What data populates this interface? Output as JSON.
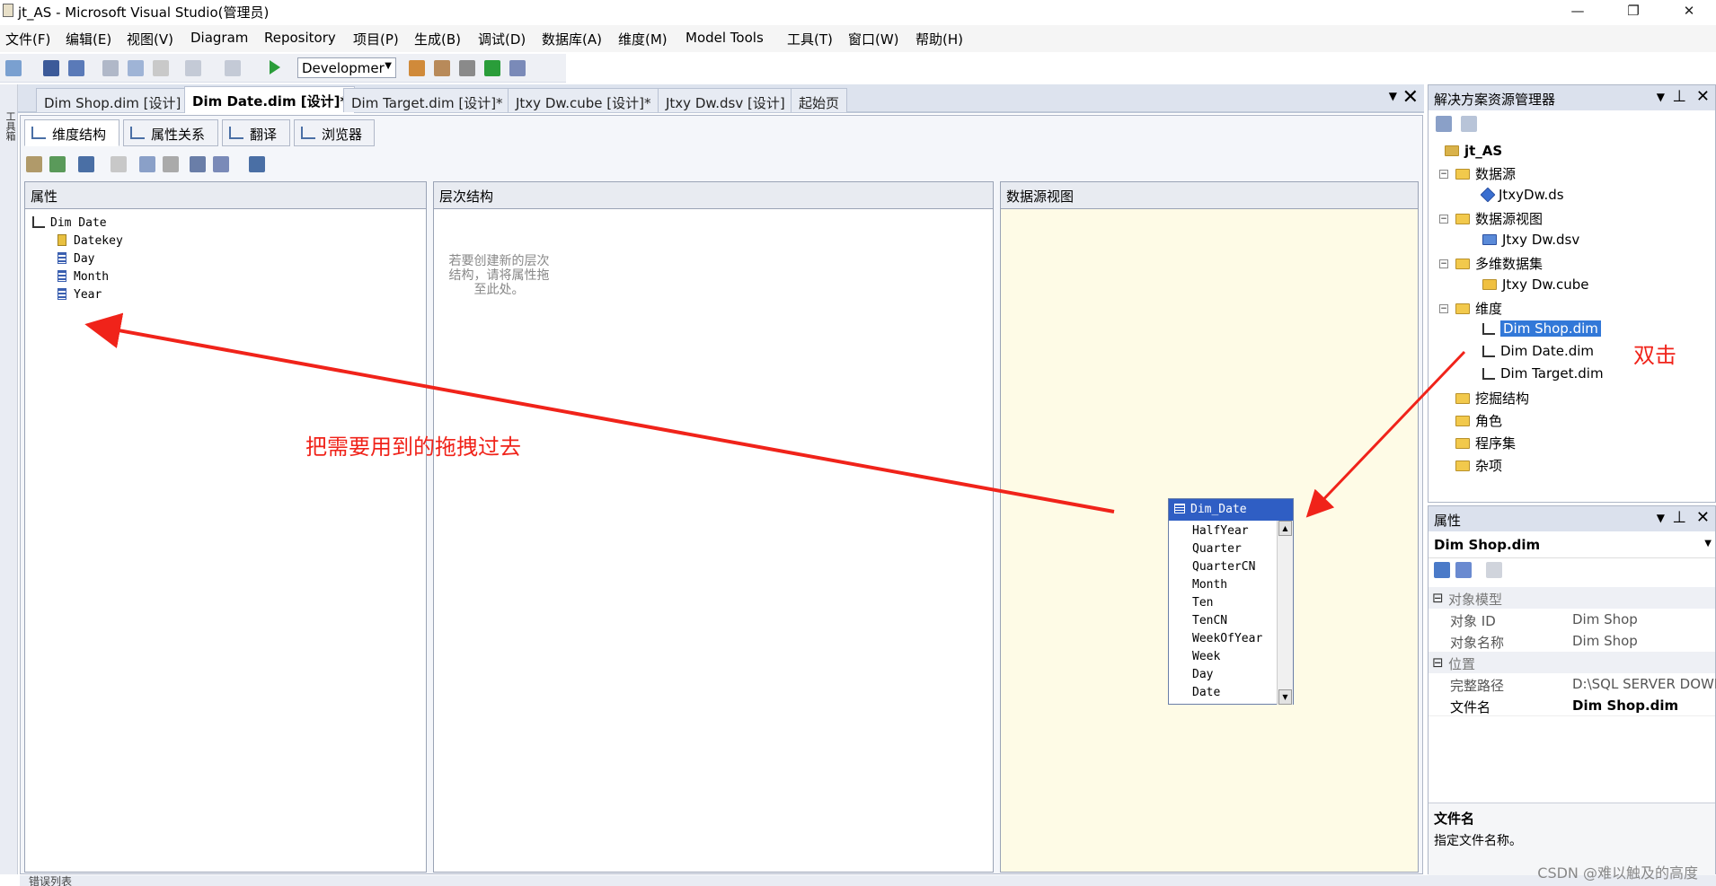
{
  "window": {
    "title": "jt_AS - Microsoft Visual Studio(管理员)",
    "min": "—",
    "restore": "❐",
    "close": "✕"
  },
  "menu": [
    "文件(F)",
    "编辑(E)",
    "视图(V)",
    "Diagram",
    "Repository",
    "项目(P)",
    "生成(B)",
    "调试(D)",
    "数据库(A)",
    "维度(M)",
    "Model Tools",
    "工具(T)",
    "窗口(W)",
    "帮助(H)"
  ],
  "toolbar": {
    "config": "Developmer"
  },
  "toolstrip": {
    "label": "工具箱"
  },
  "doc_tabs": [
    {
      "label": "Dim Shop.dim [设计]",
      "active": false
    },
    {
      "label": "Dim Date.dim [设计]*",
      "active": true
    },
    {
      "label": "Dim Target.dim [设计]*",
      "active": false
    },
    {
      "label": "Jtxy Dw.cube [设计]*",
      "active": false
    },
    {
      "label": "Jtxy Dw.dsv [设计]",
      "active": false
    },
    {
      "label": "起始页",
      "active": false
    }
  ],
  "designer_tabs": [
    "维度结构",
    "属性关系",
    "翻译",
    "浏览器"
  ],
  "panes": {
    "attributes": {
      "header": "属性",
      "root": "Dim Date",
      "items": [
        "Datekey",
        "Day",
        "Month",
        "Year"
      ]
    },
    "hierarchies": {
      "header": "层次结构",
      "hint": "若要创建新的层次结构，请将属性拖至此处。"
    },
    "dsv": {
      "header": "数据源视图",
      "table_name": "Dim_Date",
      "columns": [
        "HalfYear",
        "Quarter",
        "QuarterCN",
        "Month",
        "Ten",
        "TenCN",
        "WeekOfYear",
        "Week",
        "Day",
        "Date"
      ]
    }
  },
  "solution_explorer": {
    "title": "解决方案资源管理器",
    "project": "jt_AS",
    "nodes": [
      {
        "label": "数据源",
        "type": "folder",
        "children": [
          "JtxyDw.ds"
        ]
      },
      {
        "label": "数据源视图",
        "type": "folder",
        "children": [
          "Jtxy Dw.dsv"
        ]
      },
      {
        "label": "多维数据集",
        "type": "folder",
        "children": [
          "Jtxy Dw.cube"
        ]
      },
      {
        "label": "维度",
        "type": "folder",
        "children": [
          "Dim Shop.dim",
          "Dim Date.dim",
          "Dim Target.dim"
        ]
      },
      {
        "label": "挖掘结构",
        "type": "folder"
      },
      {
        "label": "角色",
        "type": "folder"
      },
      {
        "label": "程序集",
        "type": "folder"
      },
      {
        "label": "杂项",
        "type": "folder"
      }
    ],
    "selected": "Dim Shop.dim"
  },
  "properties": {
    "title": "属性",
    "object": "Dim Shop.dim",
    "cat_model": "对象模型",
    "cat_location": "位置",
    "rows": [
      {
        "key": "对象 ID",
        "value": "Dim Shop"
      },
      {
        "key": "对象名称",
        "value": "Dim Shop"
      },
      {
        "key": "完整路径",
        "value": "D:\\SQL SERVER DOWN"
      },
      {
        "key": "文件名",
        "value": "Dim Shop.dim"
      }
    ],
    "desc_title": "文件名",
    "desc_text": "指定文件名称。"
  },
  "status": {
    "error_list": "错误列表"
  },
  "annotations": {
    "drag_note": "把需要用到的拖拽过去",
    "dblclick_note": "双击",
    "arrow_color": "#f0231a"
  },
  "watermark": "CSDN @难以触及的高度"
}
